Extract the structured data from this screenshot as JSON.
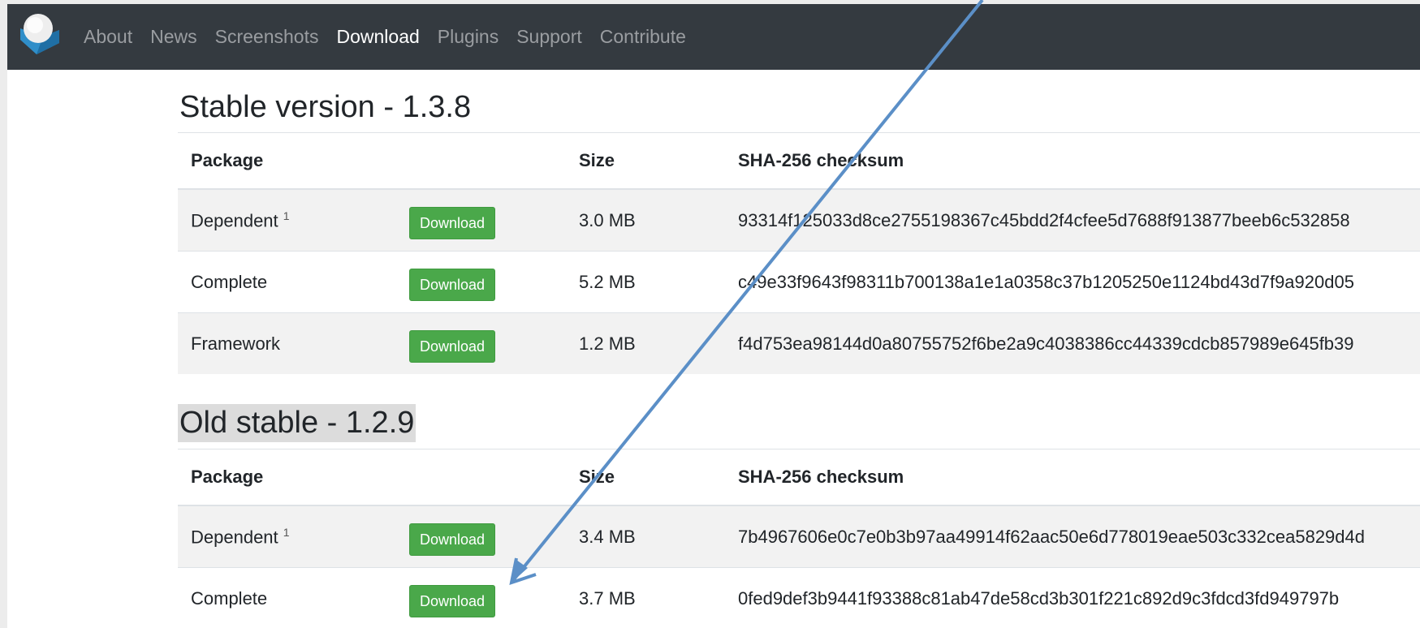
{
  "nav": {
    "links": [
      "About",
      "News",
      "Screenshots",
      "Download",
      "Plugins",
      "Support",
      "Contribute"
    ],
    "active": "Download"
  },
  "stable": {
    "title": "Stable version - 1.3.8",
    "headers": {
      "package": "Package",
      "size": "Size",
      "checksum": "SHA-256 checksum"
    },
    "rows": [
      {
        "package": "Dependent",
        "footnote": "1",
        "button": "Download",
        "size": "3.0 MB",
        "checksum": "93314f125033d8ce2755198367c45bdd2f4cfee5d7688f913877beeb6c532858"
      },
      {
        "package": "Complete",
        "footnote": "",
        "button": "Download",
        "size": "5.2 MB",
        "checksum": "c49e33f9643f98311b700138a1e1a0358c37b1205250e1124bd43d7f9a920d05"
      },
      {
        "package": "Framework",
        "footnote": "",
        "button": "Download",
        "size": "1.2 MB",
        "checksum": "f4d753ea98144d0a80755752f6be2a9c4038386cc44339cdcb857989e645fb39"
      }
    ]
  },
  "old_stable": {
    "title": "Old stable - 1.2.9",
    "headers": {
      "package": "Package",
      "size": "Size",
      "checksum": "SHA-256 checksum"
    },
    "rows": [
      {
        "package": "Dependent",
        "footnote": "1",
        "button": "Download",
        "size": "3.4 MB",
        "checksum": "7b4967606e0c7e0b3b97aa49914f62aac50e6d778019eae503c332cea5829d4d"
      },
      {
        "package": "Complete",
        "footnote": "",
        "button": "Download",
        "size": "3.7 MB",
        "checksum": "0fed9def3b9441f93388c81ab47de58cd3b301f221c892d9c3fdcd3fd949797b"
      }
    ]
  },
  "colors": {
    "navbar": "#343a40",
    "button": "#4aa84a",
    "annotation_arrow": "#5b8fc7"
  },
  "annotation": {
    "icon": "arrow-annotation"
  }
}
